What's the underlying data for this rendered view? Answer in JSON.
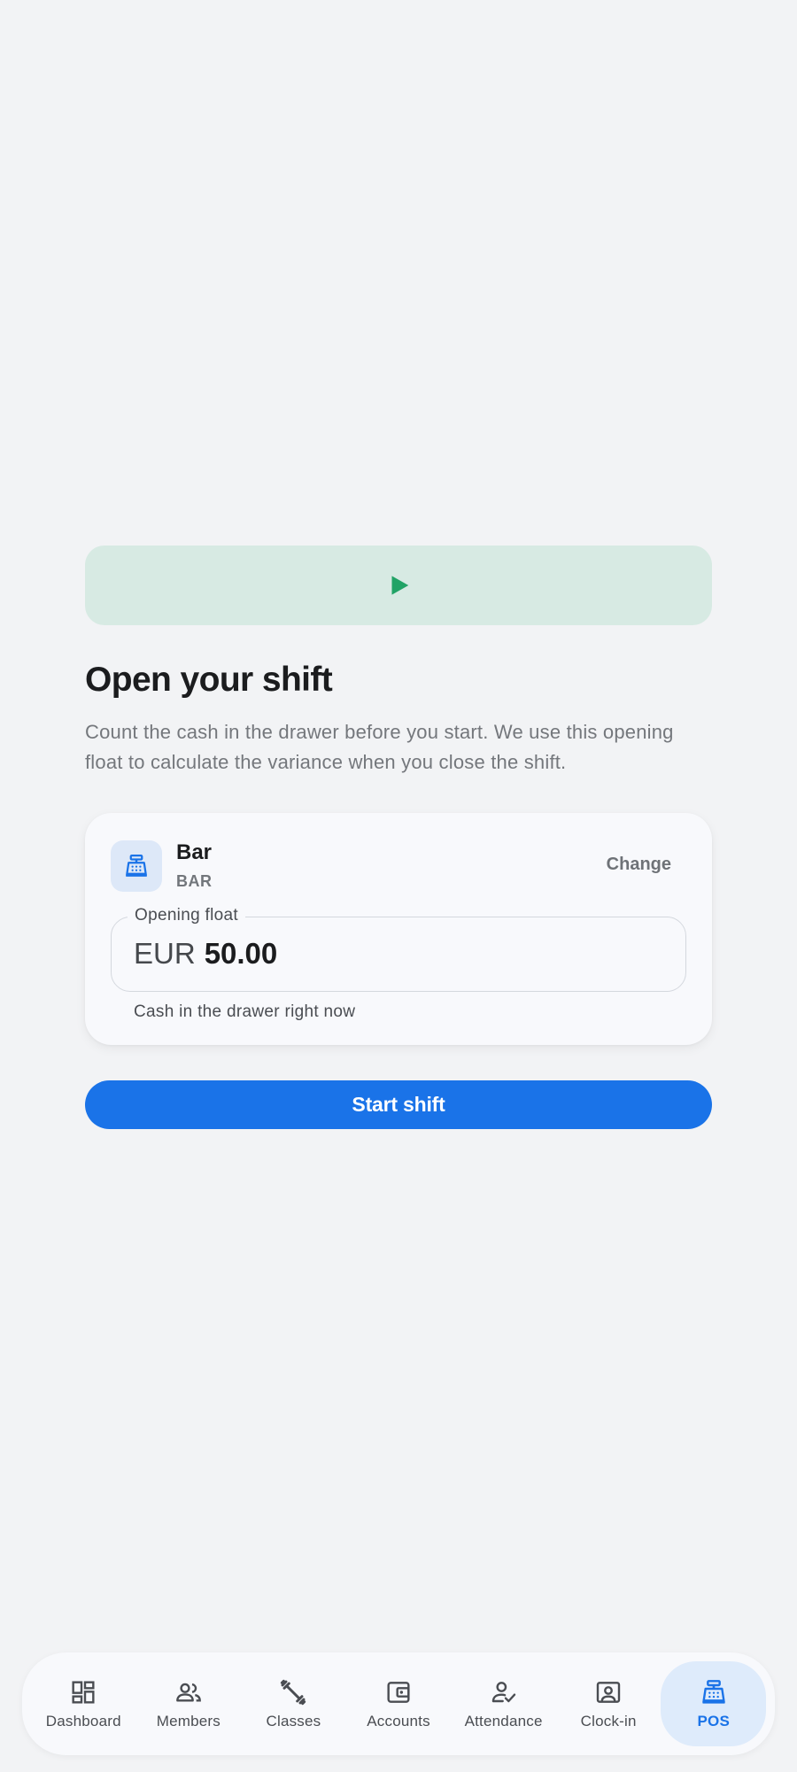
{
  "hero": {
    "icon": "play-icon",
    "color": "#21a366"
  },
  "title": "Open your shift",
  "subtitle": "Count the cash in the drawer before you start. We use this opening float to calculate the variance when you close the shift.",
  "register": {
    "icon": "cash-register-icon",
    "name": "Bar",
    "code": "BAR",
    "change_label": "Change"
  },
  "float_field": {
    "label": "Opening float",
    "currency": "EUR",
    "amount": "50.00",
    "helper": "Cash in the drawer right now"
  },
  "start_button": {
    "label": "Start shift",
    "color": "#1a73e8"
  },
  "nav": {
    "items": [
      {
        "label": "Dashboard",
        "icon": "dashboard-icon"
      },
      {
        "label": "Members",
        "icon": "members-icon"
      },
      {
        "label": "Classes",
        "icon": "dumbbell-icon"
      },
      {
        "label": "Accounts",
        "icon": "wallet-icon"
      },
      {
        "label": "Attendance",
        "icon": "person-check-icon"
      },
      {
        "label": "Clock-in",
        "icon": "badge-icon"
      },
      {
        "label": "POS",
        "icon": "cash-register-icon",
        "active": true
      }
    ]
  }
}
